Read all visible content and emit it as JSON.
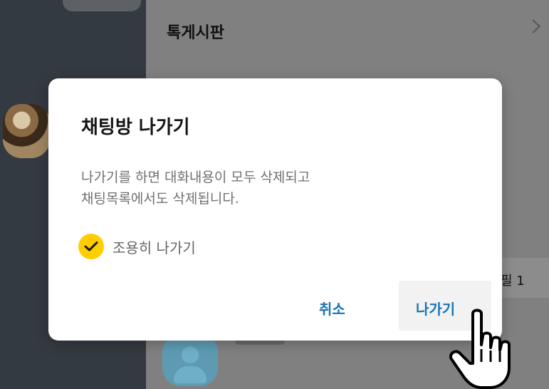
{
  "background": {
    "open_chat_title": "톡게시판",
    "card_text": "필 1"
  },
  "dialog": {
    "title": "채팅방 나가기",
    "message_lines": [
      "나가기를 하면 대화내용이 모두 삭제되고",
      "채팅목록에서도 삭제됩니다."
    ],
    "quiet_leave": {
      "label": "조용히 나가기",
      "checked": true
    },
    "cancel_label": "취소",
    "leave_label": "나가기"
  },
  "colors": {
    "accent_yellow": "#ffcd00",
    "button_blue": "#1a73b5",
    "overlay_gray": "#808080",
    "sidebar_dark": "#343a41"
  }
}
